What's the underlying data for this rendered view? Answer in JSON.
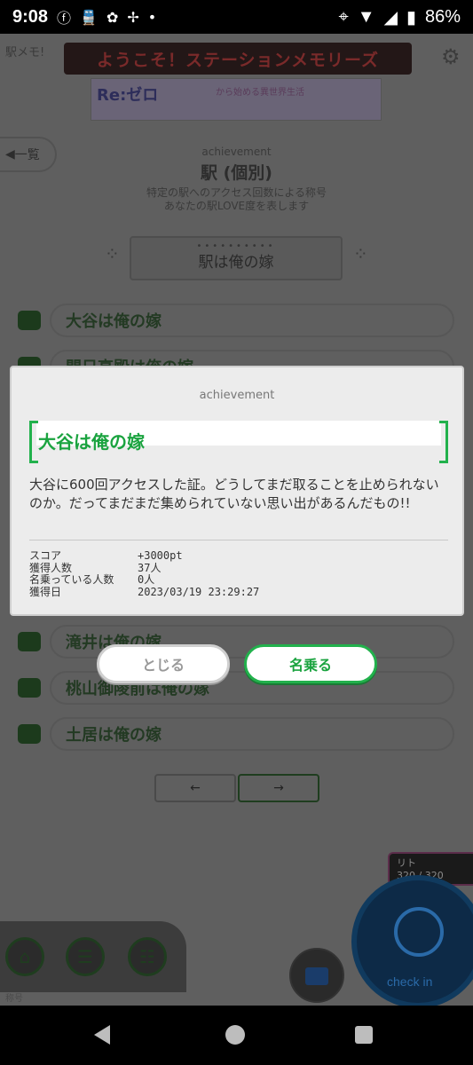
{
  "status_bar": {
    "time": "9:08",
    "battery": "86%"
  },
  "header": {
    "marquee": "ようこそ！ステーションメモリーズ",
    "banner_title": "Re:ゼロ",
    "banner_subtitle": "から始める異世界生活"
  },
  "page": {
    "back_label": "一覧",
    "section_label": "achievement",
    "section_title": "駅 (個別)",
    "description_line1": "特定の駅へのアクセス回数による称号",
    "description_line2": "あなたの駅LOVE度を表します",
    "selector_label": "駅は俺の嫁"
  },
  "list": {
    "items": [
      {
        "label": "大谷は俺の嫁"
      },
      {
        "label": "門日高殿は俺の嫁"
      },
      {
        "label": "滝井は俺の嫁"
      },
      {
        "label": "桃山御陵前は俺の嫁"
      },
      {
        "label": "土居は俺の嫁"
      }
    ]
  },
  "pager": {
    "prev": "←",
    "next": "→"
  },
  "user_panel": {
    "name": "リト",
    "value": "320 / 320"
  },
  "checkin": {
    "label": "check in"
  },
  "tabs": {
    "caption": "称号"
  },
  "dialog": {
    "label": "achievement",
    "title": "大谷は俺の嫁",
    "description": "大谷に600回アクセスした証。どうしてまだ取ることを止められないのか。だってまだまだ集められていない思い出があるんだもの!!",
    "stats": [
      {
        "key": "スコア",
        "value": "+3000pt"
      },
      {
        "key": "獲得人数",
        "value": "37人"
      },
      {
        "key": "名乗っている人数",
        "value": "0人"
      },
      {
        "key": "獲得日",
        "value": "2023/03/19 23:29:27"
      }
    ]
  },
  "buttons": {
    "close": "とじる",
    "claim": "名乗る"
  },
  "colors": {
    "accent_green": "#22b14c"
  }
}
